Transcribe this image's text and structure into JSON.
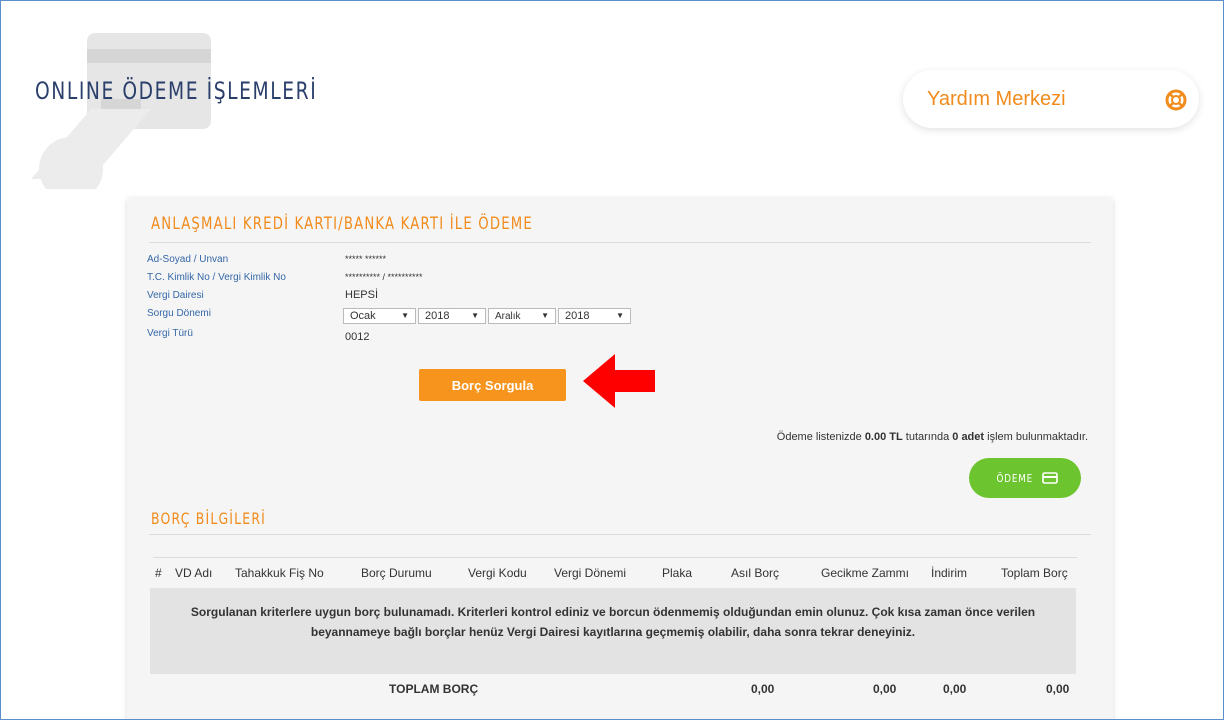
{
  "header": {
    "title": "ONLINE ÖDEME İŞLEMLERİ",
    "help_label": "Yardım Merkezi"
  },
  "panel": {
    "title": "ANLAŞMALI KREDİ KARTI/BANKA KARTI İLE ÖDEME",
    "fields": [
      {
        "label": "Ad-Soyad / Unvan",
        "value": "***** ******"
      },
      {
        "label": "T.C. Kimlik No / Vergi Kimlik No",
        "value": "********** / **********"
      },
      {
        "label": "Vergi Dairesi",
        "value": "HEPSİ"
      },
      {
        "label": "Sorgu Dönemi",
        "value": ""
      },
      {
        "label": "Vergi Türü",
        "value": "0012"
      }
    ],
    "period": {
      "start_month": "Ocak",
      "start_year": "2018",
      "end_month": "Aralık",
      "end_year": "2018"
    },
    "query_button": "Borç Sorgula",
    "summary": {
      "prefix": "Ödeme listenizde ",
      "amount": "0.00 TL",
      "middle": " tutarında ",
      "count": "0 adet",
      "suffix": " işlem bulunmaktadır."
    },
    "pay_button": "ÖDEME"
  },
  "debt": {
    "title": "BORÇ BİLGİLERİ",
    "columns": [
      "#",
      "VD Adı",
      "Tahakkuk Fiş No",
      "Borç Durumu",
      "Vergi Kodu",
      "Vergi Dönemi",
      "Plaka",
      "Asıl Borç",
      "Gecikme Zammı",
      "İndirim",
      "Toplam Borç"
    ],
    "empty_message": "Sorgulanan kriterlere uygun borç bulunamadı. Kriterleri kontrol ediniz ve borcun ödenmemiş olduğundan emin olunuz. Çok kısa zaman önce verilen beyannameye bağlı borçlar henüz Vergi Dairesi kayıtlarına geçmemiş olabilir, daha sonra tekrar deneyiniz.",
    "total": {
      "label": "TOPLAM BORÇ",
      "asil": "0,00",
      "gecikme": "0,00",
      "indirim": "0,00",
      "toplam": "0,00"
    }
  },
  "colors": {
    "accent": "#f18b1c",
    "button_orange": "#f7941d",
    "pay_green": "#6cc42f",
    "title_navy": "#2a3f6b",
    "label_blue": "#3467a8"
  }
}
